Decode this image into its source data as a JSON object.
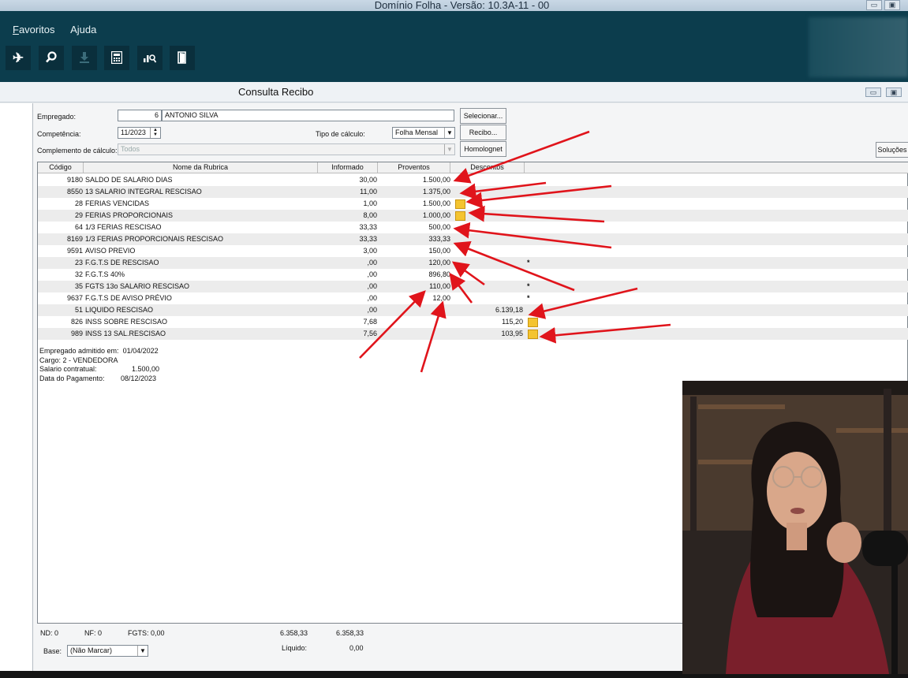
{
  "window": {
    "title": "Domínio Folha - Versão: 10.3A-11 - 00"
  },
  "menu": {
    "favoritos": "Favoritos",
    "favoritos_mnemonic": "F",
    "favoritos_rest": "avoritos",
    "ajuda": "Ajuda"
  },
  "toolbar": {
    "icons": [
      "airplane-icon",
      "search-icon",
      "download-icon",
      "calculator-icon",
      "chart-search-icon",
      "door-icon"
    ]
  },
  "subwindow": {
    "title": "Consulta Recibo"
  },
  "form": {
    "empregado_label": "Empregado:",
    "empregado_codigo": "6",
    "empregado_nome": "ANTONIO SILVA",
    "competencia_label": "Competência:",
    "competencia_value": "11/2023",
    "tipo_label": "Tipo de cálculo:",
    "tipo_value": "Folha Mensal",
    "complemento_label": "Complemento de cálculo:",
    "complemento_value": "Todos",
    "btn_selecionar": "Selecionar...",
    "btn_recibo": "Recibo...",
    "btn_homolognet": "Homolognet",
    "btn_solucoes": "Soluções"
  },
  "grid": {
    "headers": [
      "Código",
      "Nome da Rubrica",
      "Informado",
      "Proventos",
      "Descontos"
    ],
    "rows": [
      {
        "codigo": "9180",
        "nome": "SALDO DE SALARIO DIAS",
        "informado": "30,00",
        "proventos": "1.500,00",
        "descontos": "",
        "note": false,
        "star": false
      },
      {
        "codigo": "8550",
        "nome": "13 SALARIO INTEGRAL RESCISAO",
        "informado": "11,00",
        "proventos": "1.375,00",
        "descontos": "",
        "note": false,
        "star": false
      },
      {
        "codigo": "28",
        "nome": "FERIAS VENCIDAS",
        "informado": "1,00",
        "proventos": "1.500,00",
        "descontos": "",
        "note": true,
        "star": false
      },
      {
        "codigo": "29",
        "nome": "FERIAS PROPORCIONAIS",
        "informado": "8,00",
        "proventos": "1.000,00",
        "descontos": "",
        "note": true,
        "star": false
      },
      {
        "codigo": "64",
        "nome": "1/3 FERIAS RESCISAO",
        "informado": "33,33",
        "proventos": "500,00",
        "descontos": "",
        "note": false,
        "star": false
      },
      {
        "codigo": "8169",
        "nome": "1/3 FERIAS PROPORCIONAIS RESCISAO",
        "informado": "33,33",
        "proventos": "333,33",
        "descontos": "",
        "note": false,
        "star": false
      },
      {
        "codigo": "9591",
        "nome": "AVISO PREVIO",
        "informado": "3,00",
        "proventos": "150,00",
        "descontos": "",
        "note": false,
        "star": false
      },
      {
        "codigo": "23",
        "nome": "F.G.T.S DE RESCISAO",
        "informado": ",00",
        "proventos": "120,00",
        "descontos": "",
        "note": false,
        "star": true
      },
      {
        "codigo": "32",
        "nome": "F.G.T.S 40%",
        "informado": ",00",
        "proventos": "896,80",
        "descontos": "",
        "note": false,
        "star": false
      },
      {
        "codigo": "35",
        "nome": "FGTS 13o SALARIO RESCISAO",
        "informado": ",00",
        "proventos": "110,00",
        "descontos": "",
        "note": false,
        "star": true
      },
      {
        "codigo": "9637",
        "nome": "F.G.T.S DE AVISO PRÉVIO",
        "informado": ",00",
        "proventos": "12,00",
        "descontos": "",
        "note": false,
        "star": true
      },
      {
        "codigo": "51",
        "nome": "LIQUIDO RESCISAO",
        "informado": ",00",
        "proventos": "",
        "descontos": "6.139,18",
        "note": false,
        "star": false
      },
      {
        "codigo": "826",
        "nome": "INSS SOBRE RESCISAO",
        "informado": "7,68",
        "proventos": "",
        "descontos": "115,20",
        "note": true,
        "star": false
      },
      {
        "codigo": "989",
        "nome": "INSS 13 SAL.RESCISAO",
        "informado": "7,56",
        "proventos": "",
        "descontos": "103,95",
        "note": true,
        "star": false
      }
    ],
    "star_symbol": "*"
  },
  "info": {
    "admitido_label": "Empregado admitido em:",
    "admitido_value": "01/04/2022",
    "cargo": "Cargo: 2 - VENDEDORA",
    "salario_label": "Salario contratual:",
    "salario_value": "1.500,00",
    "pagamento_label": "Data do Pagamento:",
    "pagamento_value": "08/12/2023"
  },
  "footer": {
    "nd": "ND: 0",
    "nf": "NF: 0",
    "fgts": "FGTS: 0,00",
    "total_proventos": "6.358,33",
    "total_descontos": "6.358,33",
    "liquido_label": "Líquido:",
    "liquido_value": "0,00",
    "base_label": "Base:",
    "base_value": "(Não Marcar)"
  },
  "colors": {
    "app_bar": "#0c3d4d",
    "arrow": "#e0141b",
    "note_icon": "#f4c430"
  }
}
